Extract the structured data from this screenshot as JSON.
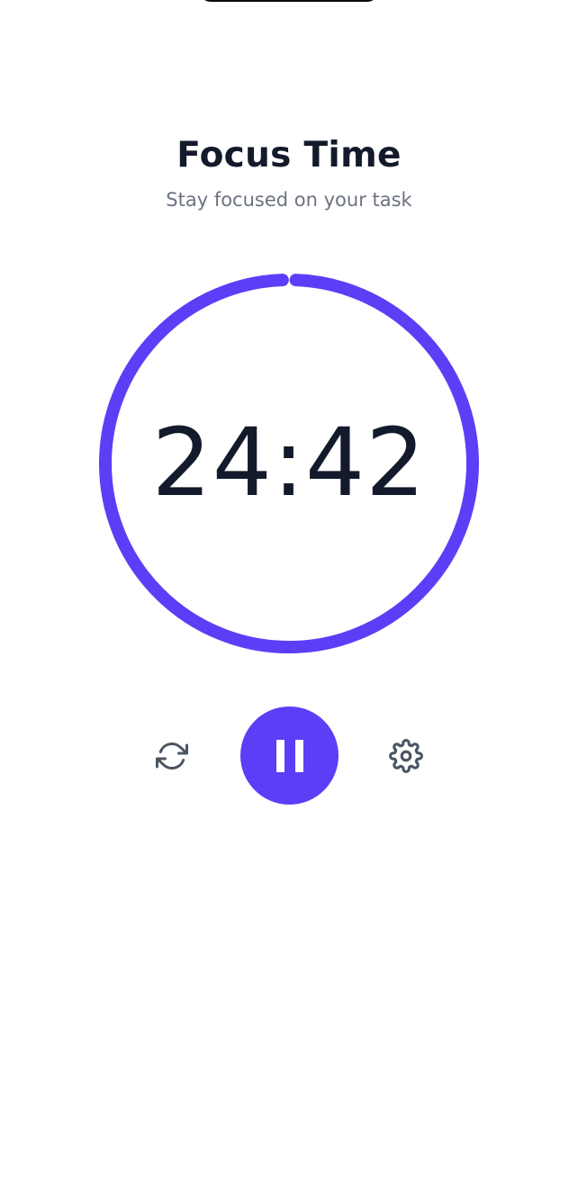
{
  "header": {
    "title": "Focus Time",
    "subtitle": "Stay focused on your task"
  },
  "timer": {
    "display": "24:42",
    "progress": 0.988
  },
  "controls": {
    "reset_icon": "refresh-icon",
    "primary_icon": "pause-icon",
    "settings_icon": "gear-icon"
  },
  "colors": {
    "accent": "#5b3ff7",
    "text_primary": "#131a2b",
    "text_secondary": "#6b7280",
    "icon": "#4b5563"
  }
}
